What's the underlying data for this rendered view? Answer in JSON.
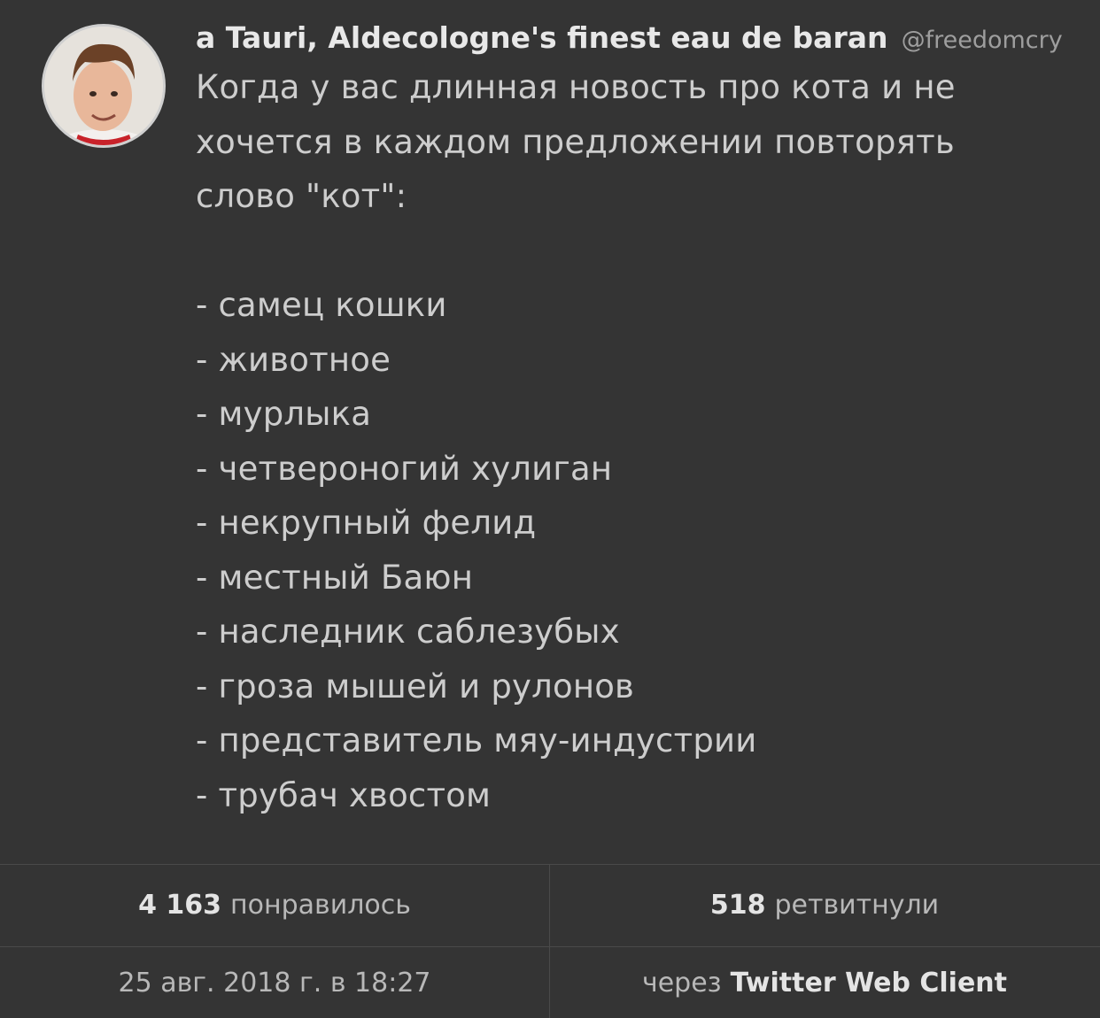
{
  "tweet": {
    "author": {
      "display_name": "a Tauri, Aldecologne's finest eau de baran",
      "handle": "@freedomcry"
    },
    "text_intro": [
      "Когда у вас длинная новость про кота и не",
      "хочется в каждом предложении повторять",
      "слово \"кот\":"
    ],
    "list_items": [
      "- самец кошки",
      "- животное",
      "- мурлыка",
      "- четвероногий хулиган",
      "- некрупный фелид",
      "- местный Баюн",
      "- наследник саблезубых",
      "- гроза мышей и рулонов",
      "- представитель мяу-индустрии",
      "- трубач хвостом"
    ]
  },
  "stats": {
    "likes_count": "4 163",
    "likes_label": "понравилось",
    "retweets_count": "518",
    "retweets_label": "ретвитнули",
    "date": "25 авг. 2018 г. в 18:27",
    "via_label": "через",
    "client": "Twitter Web Client"
  },
  "colors": {
    "background": "#343434",
    "text": "#cdcdcd",
    "divider": "#4a4a4a"
  }
}
